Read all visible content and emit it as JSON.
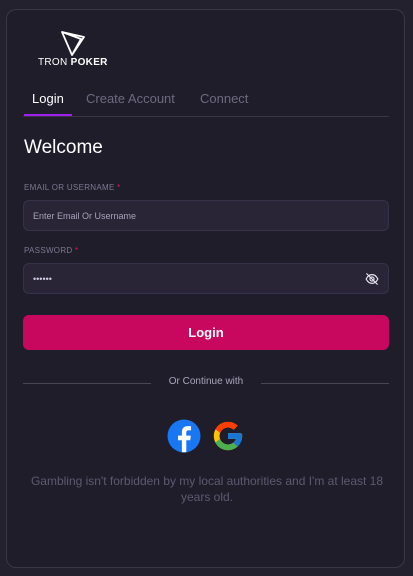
{
  "brand": {
    "name_light": "TRON",
    "name_bold": "POKER"
  },
  "tabs": [
    {
      "label": "Login",
      "active": true
    },
    {
      "label": "Create Account",
      "active": false
    },
    {
      "label": "Connect",
      "active": false
    }
  ],
  "form": {
    "heading": "Welcome",
    "email": {
      "label": "EMAIL OR USERNAME",
      "required_mark": "*",
      "placeholder": "Enter Email Or Username",
      "value": ""
    },
    "password": {
      "label": "PASSWORD",
      "required_mark": "*",
      "value": "••••••"
    },
    "submit_label": "Login"
  },
  "divider_text": "Or Continue with",
  "social": [
    {
      "icon": "facebook-icon",
      "color": "#1877f2"
    },
    {
      "icon": "google-icon"
    }
  ],
  "disclaimer": "Gambling isn't forbidden by my local authorities and I'm at least 18 years old.",
  "colors": {
    "accent": "#c8085f",
    "tab_indicator": "#a020f0",
    "required": "#e0185c",
    "background": "#201d2b"
  }
}
